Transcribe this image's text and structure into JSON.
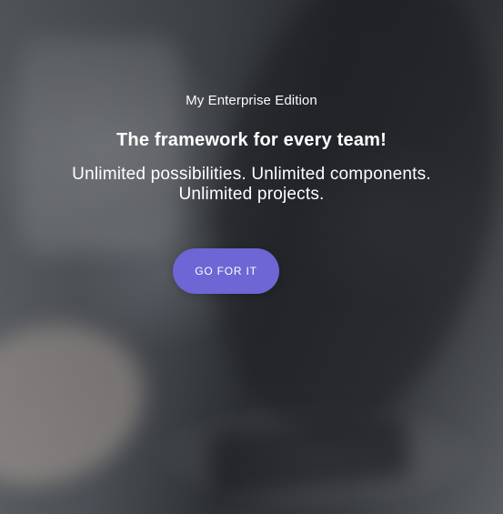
{
  "hero": {
    "eyebrow": "My Enterprise Edition",
    "headline": "The framework for every team!",
    "subtitle_line1": "Unlimited possibilities. Unlimited components.",
    "subtitle_line2": "Unlimited projects.",
    "cta_label": "GO FOR IT",
    "cta_color": "#6d66d4"
  }
}
